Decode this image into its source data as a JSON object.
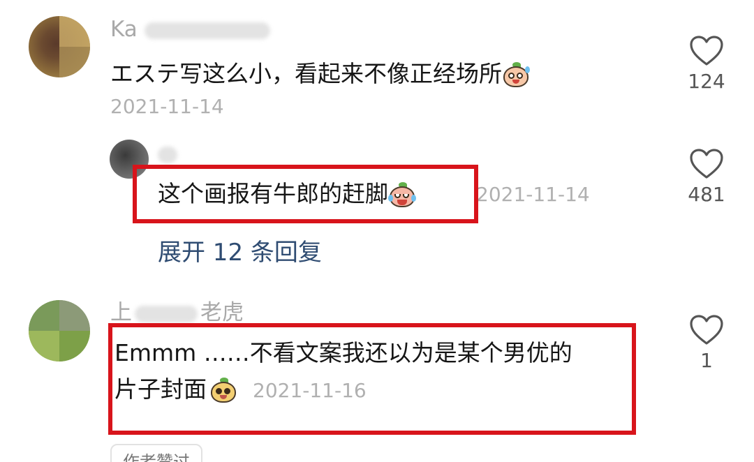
{
  "comments": [
    {
      "username_visible": "Ka",
      "text": "エステ写这么小，看起来不像正经场所",
      "emoji": "sweating-face-emoji",
      "date": "2021-11-14",
      "likes": "124"
    },
    {
      "username_visible": "",
      "text": "这个画报有牛郎的赶脚",
      "emoji": "laughing-crying-emoji",
      "date": "2021-11-14",
      "likes": "481",
      "expand_label": "展开 12 条回复"
    },
    {
      "username_visible_start": "上",
      "username_visible_end": "老虎",
      "text_line1": "Emmm ……不看文案我还以为是某个男优的",
      "text_line2": "片子封面",
      "emoji": "smiling-face-emoji",
      "date": "2021-11-16",
      "likes": "1",
      "tag": "作者赞过"
    }
  ],
  "colors": {
    "highlight": "#d8141b",
    "link": "#2f4c72",
    "meta": "#b0b0b0",
    "text": "#161616"
  }
}
